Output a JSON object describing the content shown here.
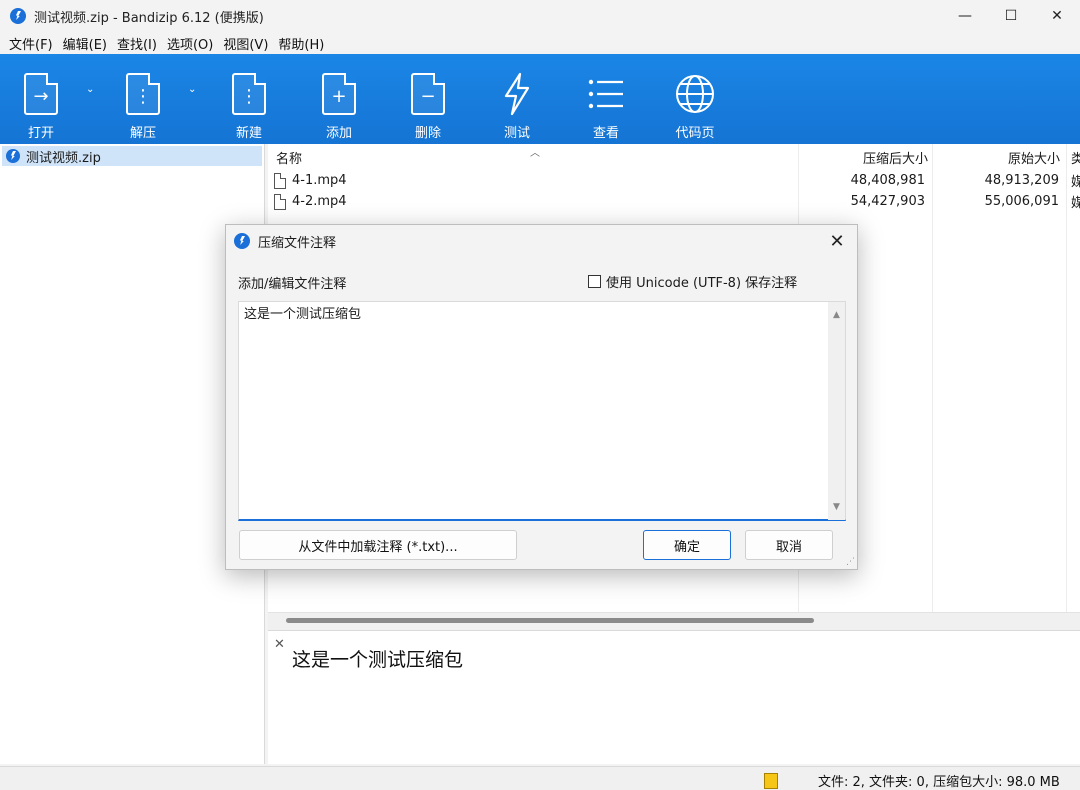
{
  "window": {
    "title": "测试视频.zip - Bandizip 6.12 (便携版)",
    "minimize": "—",
    "maximize": "☐",
    "close": "✕"
  },
  "menu": [
    "文件(F)",
    "编辑(E)",
    "查找(I)",
    "选项(O)",
    "视图(V)",
    "帮助(H)"
  ],
  "toolbar": {
    "open": "打开",
    "extract": "解压",
    "new": "新建",
    "add": "添加",
    "delete": "删除",
    "test": "测试",
    "view": "查看",
    "codepage": "代码页"
  },
  "tree": {
    "root": "测试视频.zip"
  },
  "filelist": {
    "columns": {
      "name": "名称",
      "compressed": "压缩后大小",
      "original": "原始大小",
      "type": "类"
    },
    "rows": [
      {
        "name": "4-1.mp4",
        "compressed": "48,408,981",
        "original": "48,913,209",
        "type": "媒"
      },
      {
        "name": "4-2.mp4",
        "compressed": "54,427,903",
        "original": "55,006,091",
        "type": "媒"
      }
    ]
  },
  "comment_pane": {
    "close": "✕",
    "text": "这是一个测试压缩包"
  },
  "statusbar": {
    "text": "文件: 2, 文件夹: 0, 压缩包大小: 98.0 MB"
  },
  "dialog": {
    "title": "压缩文件注释",
    "close": "✕",
    "label": "添加/编辑文件注释",
    "unicode_checkbox": "使用 Unicode (UTF-8) 保存注释",
    "unicode_checked": false,
    "comment_value": "这是一个测试压缩包",
    "load_button": "从文件中加载注释 (*.txt)...",
    "ok_button": "确定",
    "cancel_button": "取消"
  }
}
